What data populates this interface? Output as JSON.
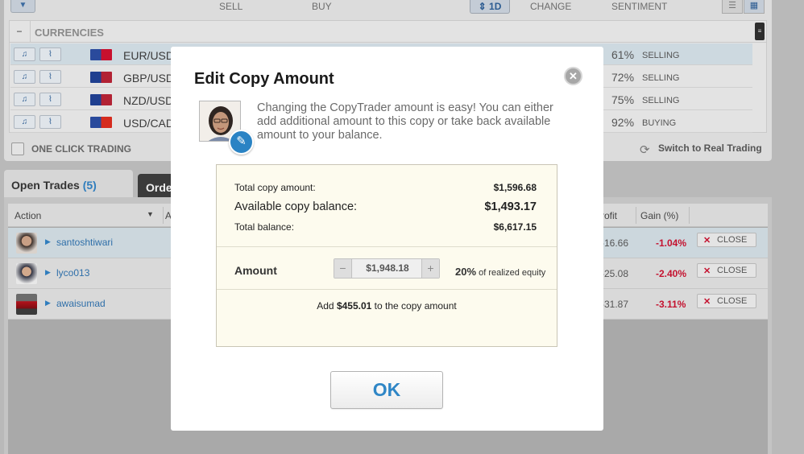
{
  "toolbar": {
    "sell": "SELL",
    "buy": "BUY",
    "period": "1D",
    "change": "CHANGE",
    "sentiment": "SENTIMENT"
  },
  "currencies": {
    "section_title": "CURRENCIES",
    "rows": [
      {
        "pair": "EUR/USD",
        "pct": "61%",
        "sentiment": "SELLING"
      },
      {
        "pair": "GBP/USD",
        "pct": "72%",
        "sentiment": "SELLING"
      },
      {
        "pair": "NZD/USD",
        "pct": "75%",
        "sentiment": "SELLING"
      },
      {
        "pair": "USD/CAD",
        "pct": "92%",
        "sentiment": "BUYING"
      }
    ]
  },
  "footer_bar": {
    "one_click": "ONE CLICK TRADING",
    "switch_real": "Switch to Real Trading"
  },
  "tabs": {
    "open_trades": "Open Trades",
    "open_trades_count": "(5)",
    "orders": "Orde"
  },
  "trades": {
    "headers": {
      "action": "Action",
      "col2": "A",
      "profit": "rofit",
      "gain": "Gain (%)"
    },
    "rows": [
      {
        "user": "santoshtiwari",
        "profit": "-16.66",
        "gain": "-1.04%",
        "close": "CLOSE"
      },
      {
        "user": "lyco013",
        "profit": "-25.08",
        "gain": "-2.40%",
        "close": "CLOSE"
      },
      {
        "user": "awaisumad",
        "profit": "-31.87",
        "gain": "-3.11%",
        "close": "CLOSE"
      }
    ]
  },
  "modal": {
    "title": "Edit Copy Amount",
    "intro": "Changing the CopyTrader amount is easy! You can either add additional amount to this copy or take back available amount to your balance.",
    "total_copy_label": "Total copy amount:",
    "total_copy_value": "$1,596.68",
    "available_label": "Available copy balance:",
    "available_value": "$1,493.17",
    "total_balance_label": "Total balance:",
    "total_balance_value": "$6,617.15",
    "amount_label": "Amount",
    "amount_value": "$1,948.18",
    "minus": "−",
    "plus": "+",
    "equity_pct": "20%",
    "equity_text": " of realized equity",
    "add_prefix": "Add ",
    "add_amount": "$455.01",
    "add_suffix": " to the copy amount",
    "ok": "OK"
  }
}
